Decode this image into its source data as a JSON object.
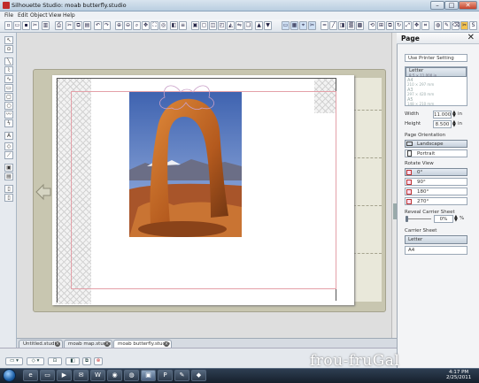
{
  "window": {
    "title": "Silhouette Studio: moab butterfly.studio",
    "controls": {
      "minimize": "–",
      "maximize": "□",
      "close": "✕"
    }
  },
  "menu": [
    "File",
    "Edit",
    "Object",
    "View",
    "Help"
  ],
  "panel": {
    "title": "Page",
    "close": "✕",
    "printer_setting": "Use Printer Setting",
    "paper_sizes": {
      "selected": "Letter",
      "selected_detail": "8.5 × 11.000 in",
      "options": [
        "A4",
        "210 × 297 mm",
        "A3",
        "297 × 420 mm",
        "A5",
        "148 × 210 mm"
      ]
    },
    "width_label": "Width",
    "width_value": "11.000",
    "width_unit": "in",
    "height_label": "Height",
    "height_value": "8.500",
    "height_unit": "in",
    "orientation_label": "Page Orientation",
    "orientation_options": [
      "Landscape",
      "Portrait"
    ],
    "orientation_selected": "Landscape",
    "rotate_label": "Rotate View",
    "rotate_options": [
      "0°",
      "90°",
      "180°",
      "270°"
    ],
    "rotate_selected": "0°",
    "reveal_label": "Reveal Carrier Sheet",
    "reveal_value": "0%",
    "reveal_unit": "%",
    "reveal_fraction": 0,
    "carrier_label": "Carrier Sheet",
    "carrier_options": [
      "Letter",
      "A4"
    ],
    "carrier_selected": "Letter"
  },
  "tabs": [
    {
      "label": "Untitled.studio",
      "active": false
    },
    {
      "label": "moab map.studio",
      "active": false
    },
    {
      "label": "moab butterfly.studio",
      "active": true
    }
  ],
  "taskbar": {
    "time": "4:17 PM",
    "date": "2/25/2011"
  },
  "watermark": "frou-fruGal",
  "colors": {
    "accent": "#1d5fa6",
    "cut_margin": "#e4a0a8",
    "mat": "#c8c6b0"
  }
}
